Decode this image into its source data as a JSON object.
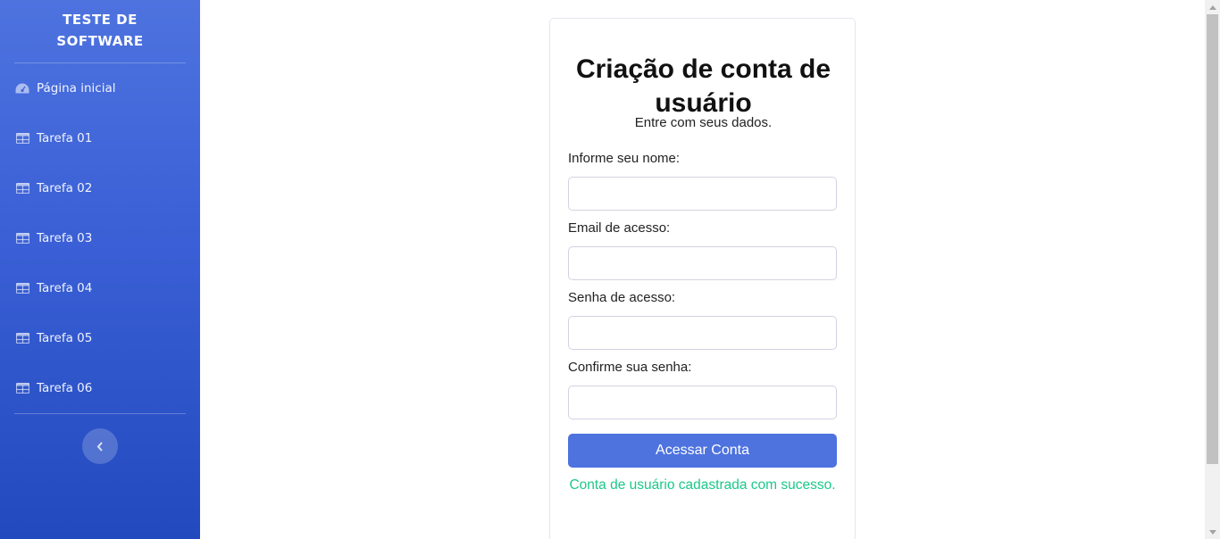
{
  "sidebar": {
    "brand_line1": "TESTE DE",
    "brand_line2": "SOFTWARE",
    "items": [
      {
        "label": "Página inicial",
        "icon": "dashboard-icon"
      },
      {
        "label": "Tarefa 01",
        "icon": "table-icon"
      },
      {
        "label": "Tarefa 02",
        "icon": "table-icon"
      },
      {
        "label": "Tarefa 03",
        "icon": "table-icon"
      },
      {
        "label": "Tarefa 04",
        "icon": "table-icon"
      },
      {
        "label": "Tarefa 05",
        "icon": "table-icon"
      },
      {
        "label": "Tarefa 06",
        "icon": "table-icon"
      }
    ],
    "toggle_icon": "chevron-left-icon"
  },
  "form": {
    "title": "Criação de conta de usuário",
    "subtitle": "Entre com seus dados.",
    "fields": [
      {
        "label": "Informe seu nome:",
        "value": ""
      },
      {
        "label": "Email de acesso:",
        "value": ""
      },
      {
        "label": "Senha de acesso:",
        "value": ""
      },
      {
        "label": "Confirme sua senha:",
        "value": ""
      }
    ],
    "submit_label": "Acessar Conta",
    "success_message": "Conta de usuário cadastrada com sucesso."
  },
  "colors": {
    "primary": "#4e73df",
    "sidebar_dark": "#224abe",
    "success": "#1cc88a"
  }
}
